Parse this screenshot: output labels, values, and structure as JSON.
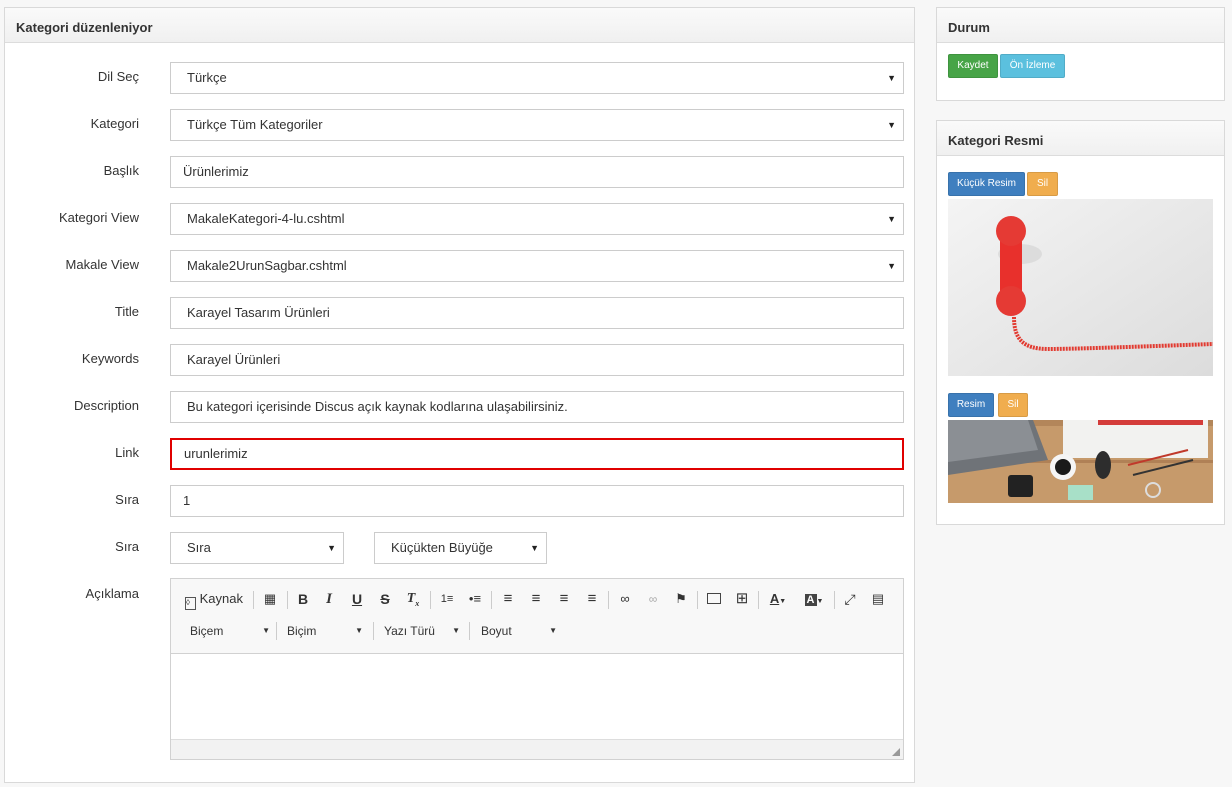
{
  "main": {
    "title": "Kategori düzenleniyor",
    "fields": {
      "dil": {
        "label": "Dil Seç",
        "value": "Türkçe"
      },
      "kategori": {
        "label": "Kategori",
        "value": "Türkçe Tüm Kategoriler"
      },
      "baslik": {
        "label": "Başlık",
        "value": "Ürünlerimiz"
      },
      "kategori_view": {
        "label": "Kategori View",
        "value": "MakaleKategori-4-lu.cshtml"
      },
      "makale_view": {
        "label": "Makale View",
        "value": "Makale2UrunSagbar.cshtml"
      },
      "title": {
        "label": "Title",
        "value": "Karayel Tasarım Ürünleri"
      },
      "keywords": {
        "label": "Keywords",
        "value": "Karayel Ürünleri"
      },
      "description": {
        "label": "Description",
        "value": "Bu kategori içerisinde Discus açık kaynak kodlarına ulaşabilirsiniz."
      },
      "link": {
        "label": "Link",
        "value": "urunlerimiz"
      },
      "sira": {
        "label": "Sıra",
        "value": "1"
      },
      "sira_order": {
        "label": "Sıra",
        "value": "Sıra",
        "direction": "Küçükten Büyüğe"
      },
      "aciklama": {
        "label": "Açıklama"
      }
    },
    "editor": {
      "source_label": "Kaynak",
      "combos": [
        {
          "label": "Biçem"
        },
        {
          "label": "Biçim"
        },
        {
          "label": "Yazı Türü"
        },
        {
          "label": "Boyut"
        }
      ]
    }
  },
  "durum": {
    "title": "Durum",
    "save_label": "Kaydet",
    "preview_label": "Ön İzleme"
  },
  "resim": {
    "title": "Kategori Resmi",
    "small_label": "Küçük Resim",
    "delete_label": "Sil",
    "large_label": "Resim",
    "delete2_label": "Sil"
  },
  "colors": {
    "highlight": "#e00000",
    "green": "#47a447",
    "blue": "#5bc0de",
    "navy": "#3f7fbf",
    "orange": "#f0ad4e"
  }
}
